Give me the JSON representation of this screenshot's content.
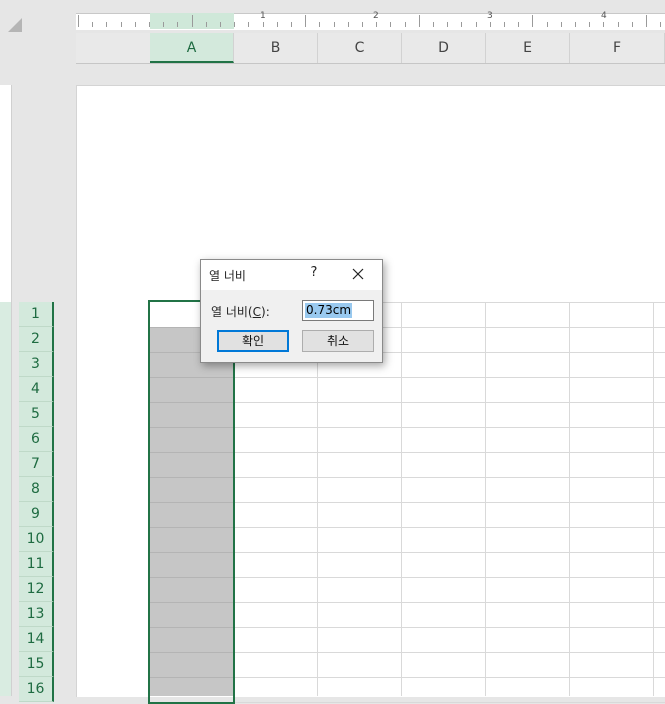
{
  "ruler": {
    "numbers": [
      "1",
      "2",
      "3",
      "4"
    ]
  },
  "columns": [
    "A",
    "B",
    "C",
    "D",
    "E",
    "F"
  ],
  "selected_column": "A",
  "rows": [
    "1",
    "2",
    "3",
    "4",
    "5",
    "6",
    "7",
    "8",
    "9",
    "10",
    "11",
    "12",
    "13",
    "14",
    "15",
    "16"
  ],
  "dialog": {
    "title": "열 너비",
    "help_label": "?",
    "field_label": "열 너비(",
    "field_mnemonic": "C",
    "field_label_suffix": "):",
    "field_value": "0.73cm",
    "ok_label": "확인",
    "cancel_label": "취소"
  },
  "colors": {
    "accent": "#217346",
    "selection_fill": "#c6c6c6",
    "input_highlight": "#99c9ef"
  }
}
